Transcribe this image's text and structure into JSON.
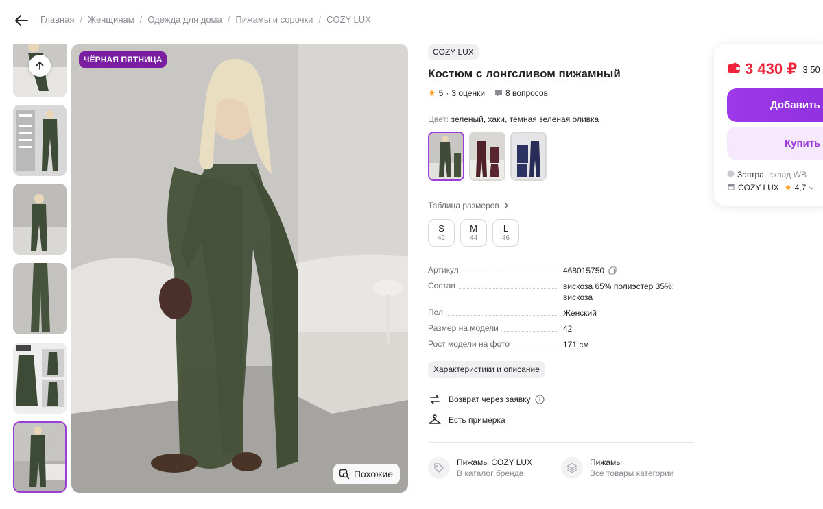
{
  "breadcrumb": [
    "Главная",
    "Женщинам",
    "Одежда для дома",
    "Пижамы и сорочки",
    "COZY LUX"
  ],
  "gallery": {
    "promo_badge": "ЧЁРНАЯ ПЯТНИЦА",
    "similar_label": "Похожие",
    "thumb_count": 6,
    "active_thumb": 6
  },
  "product": {
    "brand": "COZY LUX",
    "title": "Костюм с лонгсливом пижамный",
    "rating": "5",
    "rating_sep": "·",
    "reviews": "3 оценки",
    "questions": "8 вопросов",
    "color_label": "Цвет:",
    "color_value": "зеленый, хаки, темная зеленая оливка",
    "size_table": "Таблица размеров",
    "sizes": [
      {
        "letter": "S",
        "ru": "42"
      },
      {
        "letter": "M",
        "ru": "44"
      },
      {
        "letter": "L",
        "ru": "46"
      }
    ],
    "specs": [
      {
        "k": "Артикул",
        "v": "468015750"
      },
      {
        "k": "Состав",
        "v": "вискоза 65% полиэстер 35%; вискоза"
      },
      {
        "k": "Пол",
        "v": "Женский"
      },
      {
        "k": "Размер на модели",
        "v": "42"
      },
      {
        "k": "Рост модели на фото",
        "v": "171 см"
      }
    ],
    "description_button": "Характеристики и описание",
    "return_policy": "Возврат через заявку",
    "fitting": "Есть примерка",
    "links": [
      {
        "title": "Пижамы COZY LUX",
        "sub": "В каталог бренда"
      },
      {
        "title": "Пижамы",
        "sub": "Все товары категории"
      }
    ]
  },
  "buy": {
    "price": "3 430 ₽",
    "old_price": "3 50",
    "cart_label": "Добавить",
    "buy_label": "Купить",
    "delivery_day": "Завтра,",
    "delivery_place": "склад WB",
    "seller": "COZY LUX",
    "seller_rating": "4,7"
  },
  "colors": {
    "accent": "#9b3ed8",
    "price": "#f0233c",
    "promo": "#7b1fa2",
    "star": "#ff9b18"
  }
}
